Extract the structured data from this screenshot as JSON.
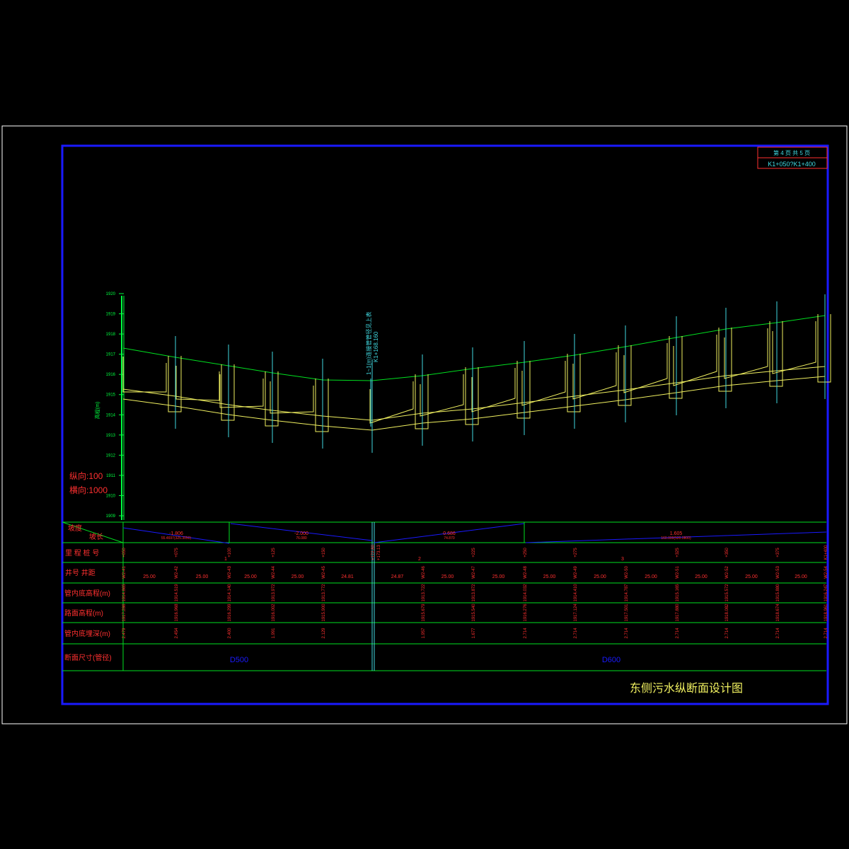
{
  "colors": {
    "background": "#000000",
    "outer_frame": "#ffffff",
    "inner_frame": "#1a1aff",
    "table_lines": "#00e020",
    "ground_line": "#00e020",
    "pipe_line": "#f0f060",
    "manhole_axis": "#40d8e0",
    "row_label": "#ff3030",
    "row_value": "#ff3030",
    "axis": "#00ff40",
    "title": "#f0f060",
    "title_block": "#40d8e0"
  },
  "title_block": {
    "page_info": "第 4 页    共 5 页",
    "range": "K1+050?K1+400"
  },
  "drawing_title": "东侧污水纵断面设计图",
  "scale": {
    "vertical": "纵向:100",
    "horizontal": "横向:1000"
  },
  "elevation_axis": {
    "label": "高程(m)",
    "ticks": [
      "1920",
      "1919",
      "1918",
      "1917",
      "1916",
      "1915",
      "1914",
      "1913",
      "1912",
      "1911",
      "1910",
      "1909"
    ]
  },
  "connection_note": {
    "line1": "1~1(m)连接管管径见上表",
    "line2": "K1+168.160"
  },
  "row_labels": {
    "slope": "坡度",
    "length": "坡长",
    "chainage": "里 程 桩 号",
    "well": "井号    井距",
    "invert": "管内底高程(m)",
    "ground": "路面高程(m)",
    "depth": "管内底埋深(m)",
    "section": "断面尺寸(管径)"
  },
  "slope_segments": [
    {
      "slope": "-1.806",
      "length": "55.4697(325.3050)"
    },
    {
      "slope": "-2.000",
      "length": "76.080"
    },
    {
      "slope": "0.686",
      "length": "74.870"
    },
    {
      "slope": "1.605",
      "length": "160.000(520.0800)"
    }
  ],
  "chainages": [
    "+050",
    "+075",
    "+100",
    "+125",
    "+150",
    "+172.80",
    "",
    "+225",
    "+250",
    "+275",
    "",
    "+325",
    "+350",
    "+375",
    "K1+400"
  ],
  "chainage_marks": [
    "",
    "",
    "1",
    "",
    "",
    "",
    "2",
    "",
    "",
    "",
    "3",
    "",
    "",
    "",
    ""
  ],
  "chainage_extra": "+173.13",
  "wells": [
    "W2-41",
    "W2-42",
    "W2-43",
    "W2-44",
    "W2-45",
    "",
    "W2-46",
    "W2-47",
    "W2-48",
    "W2-49",
    "W2-50",
    "W2-51",
    "W2-52",
    "W2-53",
    "W2-54"
  ],
  "spacings": [
    "25.00",
    "25.00",
    "25.00",
    "25.00",
    "24.81",
    "24.87",
    "25.00",
    "25.00",
    "25.00",
    "25.00",
    "25.00",
    "25.00",
    "25.00",
    "25.00"
  ],
  "inverts": [
    "1914.865",
    "1914.519",
    "1914.140",
    "1913.972",
    "1913.772",
    "",
    "1913.722",
    "1913.872",
    "1914.032",
    "1914.410",
    "1914.787",
    "1915.165",
    "1915.572",
    "1915.880",
    "1916.247"
  ],
  "grounds": [
    "1917.286",
    "1916.968",
    "1916.299",
    "1916.002",
    "1915.900",
    "",
    "1915.679",
    "1915.540",
    "1916.276",
    "1917.124",
    "1917.501",
    "1917.880",
    "1918.082",
    "1918.674",
    "1918.961"
  ],
  "depths": [
    "2.479",
    "2.454",
    "2.400",
    "1.991",
    "2.129",
    "",
    "1.957",
    "1.677",
    "2.714",
    "2.714",
    "2.714",
    "2.714",
    "2.714",
    "2.714",
    "2.714"
  ],
  "sections": [
    "D500",
    "D600"
  ]
}
